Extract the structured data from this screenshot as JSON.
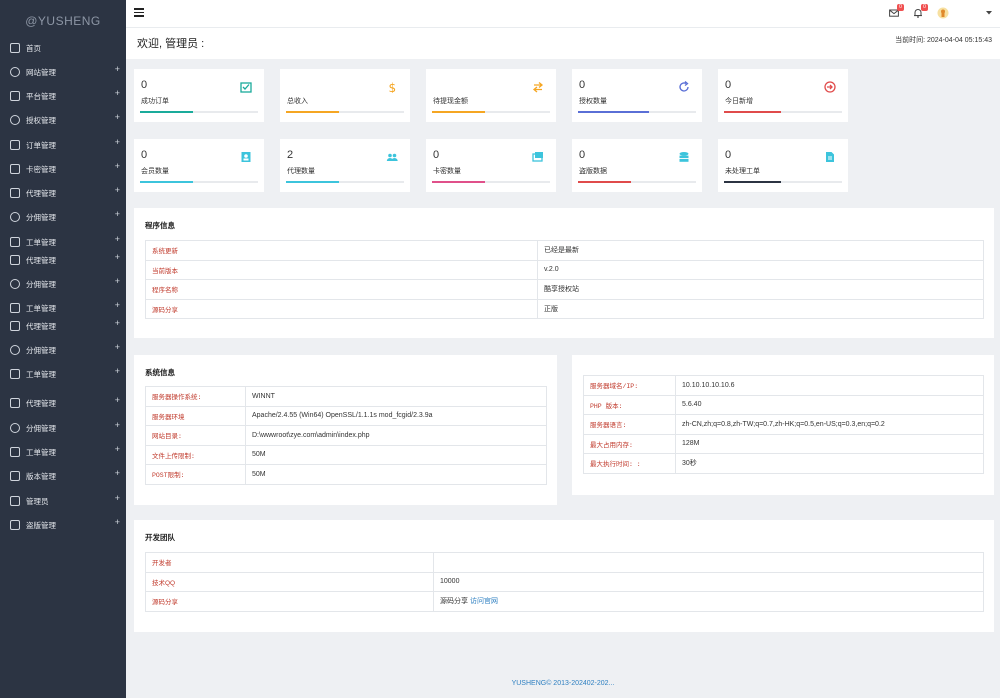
{
  "brand": "@YUSHENG",
  "sidebar": {
    "items": [
      {
        "label": "首页",
        "icon": "home-icon",
        "plus": false
      },
      {
        "label": "网站管理",
        "icon": "gear-icon",
        "plus": true
      },
      {
        "label": "平台管理",
        "icon": "menu-icon",
        "plus": true
      },
      {
        "label": "授权管理",
        "icon": "shield-icon",
        "plus": true
      },
      {
        "label": "订单管理",
        "icon": "folder-icon",
        "plus": true
      },
      {
        "label": "卡密管理",
        "icon": "folder-icon",
        "plus": true
      },
      {
        "label": "代理管理",
        "icon": "user-icon",
        "plus": true
      },
      {
        "label": "分佣管理",
        "icon": "coin-icon",
        "plus": true
      },
      {
        "label": "工单管理",
        "icon": "monitor-icon",
        "plus": true
      },
      {
        "label": "代理管理",
        "icon": "user-icon",
        "plus": true
      },
      {
        "label": "分佣管理",
        "icon": "coin-icon",
        "plus": true
      },
      {
        "label": "工单管理",
        "icon": "monitor-icon",
        "plus": true
      },
      {
        "label": "代理管理",
        "icon": "user-icon",
        "plus": true
      },
      {
        "label": "分佣管理",
        "icon": "coin-icon",
        "plus": true
      },
      {
        "label": "工单管理",
        "icon": "monitor-icon",
        "plus": true
      },
      {
        "label": "代理管理",
        "icon": "user-icon",
        "plus": true
      },
      {
        "label": "分佣管理",
        "icon": "coin-icon",
        "plus": true
      },
      {
        "label": "工单管理",
        "icon": "monitor-icon",
        "plus": true
      },
      {
        "label": "版本管理",
        "icon": "grid-icon",
        "plus": true
      },
      {
        "label": "管理员",
        "icon": "user-icon",
        "plus": true
      },
      {
        "label": "盗版管理",
        "icon": "layers-icon",
        "plus": true
      }
    ]
  },
  "topbar": {
    "mail_badge": "0",
    "bell_badge": "0"
  },
  "header": {
    "welcome": "欢迎, 管理员 :",
    "current_time": "当前时间: 2024-04-04 05:15:43"
  },
  "stats": [
    {
      "value": "0",
      "label": "成功订单",
      "color": "#1aab9b",
      "fill": 0.45,
      "icon": "check-box-icon"
    },
    {
      "value": "",
      "label": "总收入",
      "color": "#f5a623",
      "fill": 0.45,
      "icon": "dollar-icon"
    },
    {
      "value": "",
      "label": "待提现金额",
      "color": "#f5a623",
      "fill": 0.45,
      "icon": "transfer-icon"
    },
    {
      "value": "0",
      "label": "授权数量",
      "color": "#5a6fd6",
      "fill": 0.6,
      "icon": "refresh-icon"
    },
    {
      "value": "0",
      "label": "今日新增",
      "color": "#e04b4b",
      "fill": 0.48,
      "icon": "login-icon"
    },
    {
      "value": "0",
      "label": "会员数量",
      "color": "#3cc4dc",
      "fill": 0.45,
      "icon": "user-box-icon"
    },
    {
      "value": "2",
      "label": "代理数量",
      "color": "#3cc4dc",
      "fill": 0.45,
      "icon": "users-icon"
    },
    {
      "value": "0",
      "label": "卡密数量",
      "color": "#e0508a",
      "fill": 0.45,
      "icon": "cards-icon"
    },
    {
      "value": "0",
      "label": "盗版数据",
      "color": "#e04b4b",
      "fill": 0.45,
      "icon": "database-icon"
    },
    {
      "value": "0",
      "label": "未处理工单",
      "color": "#2c3443",
      "fill": 0.48,
      "icon": "file-icon"
    }
  ],
  "program_info": {
    "title": "程序信息",
    "rows": [
      {
        "k": "系统更新",
        "v": "已经是最新"
      },
      {
        "k": "当前版本",
        "v": "v.2.0"
      },
      {
        "k": "程序名称",
        "v": "酷享授权站"
      },
      {
        "k": "源码分享",
        "v": "正版"
      }
    ]
  },
  "system_info": {
    "title": "系统信息",
    "rows": [
      {
        "k": "服务器操作系统:",
        "v": "WINNT"
      },
      {
        "k": "服务器环境",
        "v": "Apache/2.4.55 (Win64) OpenSSL/1.1.1s mod_fcgid/2.3.9a"
      },
      {
        "k": "网站目录:",
        "v": "D:\\wwwroot\\zye.com\\admin\\index.php"
      },
      {
        "k": "文件上传限制:",
        "v": "50M"
      },
      {
        "k": "POST限制:",
        "v": "50M"
      }
    ]
  },
  "server_info": {
    "rows": [
      {
        "k": "服务器域名/IP:",
        "v": "10.10.10.10.10.6"
      },
      {
        "k": "PHP 版本:",
        "v": "5.6.40"
      },
      {
        "k": "服务器语言:",
        "v": "zh-CN,zh;q=0.8,zh-TW;q=0.7,zh-HK;q=0.5,en-US;q=0.3,en;q=0.2"
      },
      {
        "k": "最大占用内存:",
        "v": "128M"
      },
      {
        "k": "最大执行时间: :",
        "v": "30秒"
      }
    ]
  },
  "dev_team": {
    "title": "开发团队",
    "rows": [
      {
        "k": "开发者",
        "v": ""
      },
      {
        "k": "技术QQ",
        "v": "10000"
      },
      {
        "k": "源码分享",
        "v": "源码分享 ",
        "link": "访问官网"
      }
    ]
  },
  "footer": "YUSHENG© 2013-202402-202..."
}
